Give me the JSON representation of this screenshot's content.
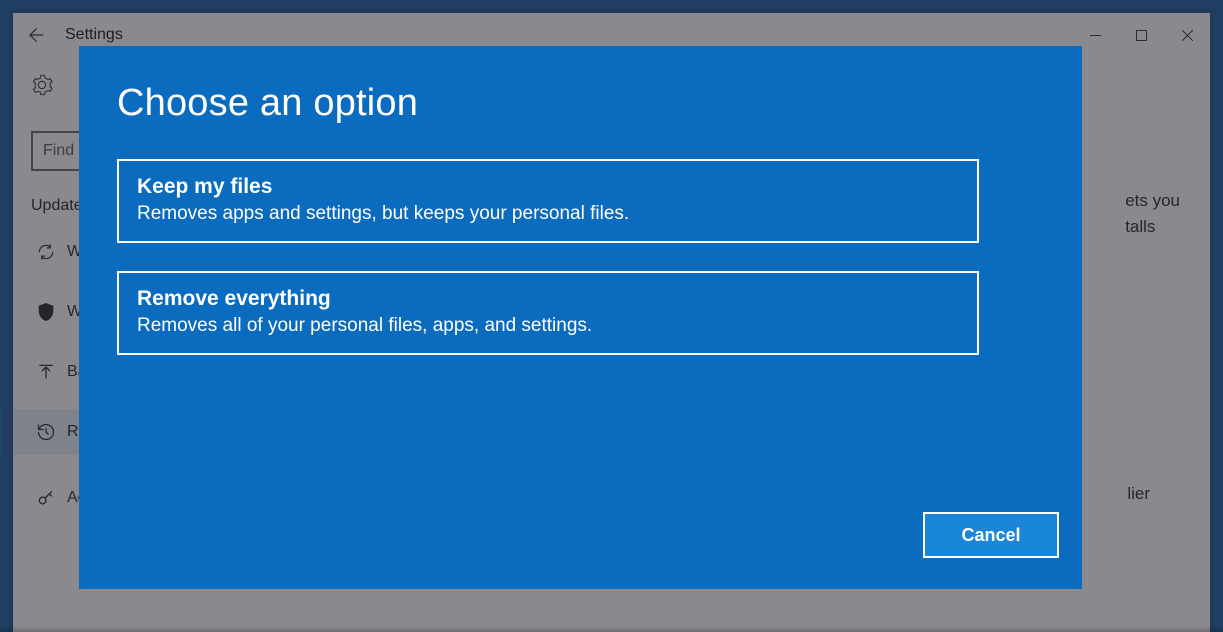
{
  "window": {
    "title": "Settings",
    "search_placeholder": "Find a setting",
    "category": "Update & security",
    "nav": [
      {
        "label": "Windows Update"
      },
      {
        "label": "Windows Defender"
      },
      {
        "label": "Backup"
      },
      {
        "label": "Recovery"
      },
      {
        "label": "Activation"
      }
    ],
    "body_fragment1": "ets you",
    "body_fragment2": "talls",
    "body_fragment3": "lier"
  },
  "dialog": {
    "title": "Choose an option",
    "options": [
      {
        "title": "Keep my files",
        "desc": "Removes apps and settings, but keeps your personal files."
      },
      {
        "title": "Remove everything",
        "desc": "Removes all of your personal files, apps, and settings."
      }
    ],
    "cancel": "Cancel"
  }
}
